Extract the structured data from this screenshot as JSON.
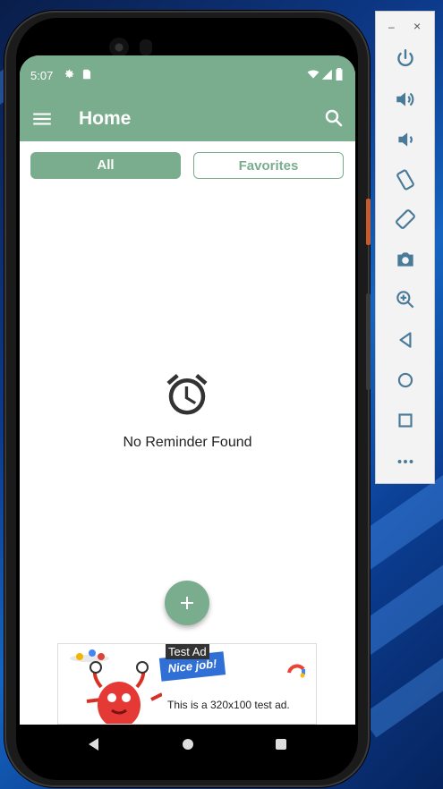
{
  "status_bar": {
    "time": "5:07"
  },
  "app_bar": {
    "title": "Home"
  },
  "tabs": [
    {
      "label": "All",
      "active": true
    },
    {
      "label": "Favorites",
      "active": false
    }
  ],
  "empty_state": {
    "message": "No Reminder Found",
    "icon": "alarm-clock-icon"
  },
  "ad": {
    "label": "Test Ad",
    "ribbon_text": "Nice job!",
    "text": "This is a 320x100 test ad."
  },
  "emulator_panel": {
    "minimize": "–",
    "close": "×"
  },
  "colors": {
    "primary": "#7aad8e",
    "icon_dark": "#333333"
  }
}
